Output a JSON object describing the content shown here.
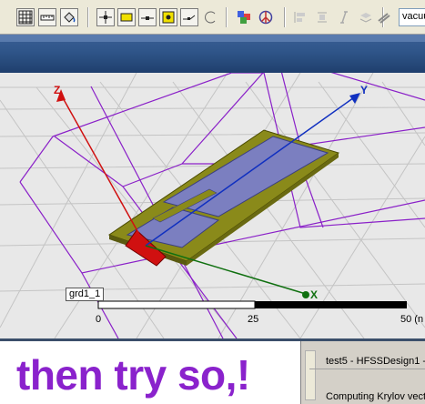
{
  "toolbar": {
    "buttons": [
      {
        "icon": "grid-icon"
      },
      {
        "icon": "ruler-icon"
      },
      {
        "icon": "paint-bucket-icon"
      },
      {
        "icon": "select-move-icon"
      },
      {
        "icon": "rectangle-icon"
      },
      {
        "icon": "line-icon"
      },
      {
        "icon": "point-icon"
      },
      {
        "icon": "snap-icon"
      },
      {
        "icon": "arc-icon"
      },
      {
        "icon": "boolean-icon"
      },
      {
        "icon": "peace-icon"
      },
      {
        "icon": "align-icon"
      },
      {
        "icon": "distribute-icon"
      },
      {
        "icon": "italic-icon"
      },
      {
        "icon": "stack-icon"
      }
    ],
    "material_value": "vacuum"
  },
  "view": {
    "axes": {
      "z": "Z",
      "y": "Y",
      "x": "X"
    },
    "grid_label": "grd1_1",
    "scale_ticks": [
      "0",
      "25",
      "50 (n"
    ],
    "colors": {
      "axis_z": "#d01010",
      "axis_y": "#1030c0",
      "axis_x": "#107010",
      "wire": "#8a20c8",
      "substrate": "#8a8a1a",
      "patch": "#7b7fc0"
    }
  },
  "bottom": {
    "overlay_text": "then try so,!",
    "message_title": "test5 - HFSSDesign1 -",
    "message_text": "Computing Krylov vecto"
  }
}
